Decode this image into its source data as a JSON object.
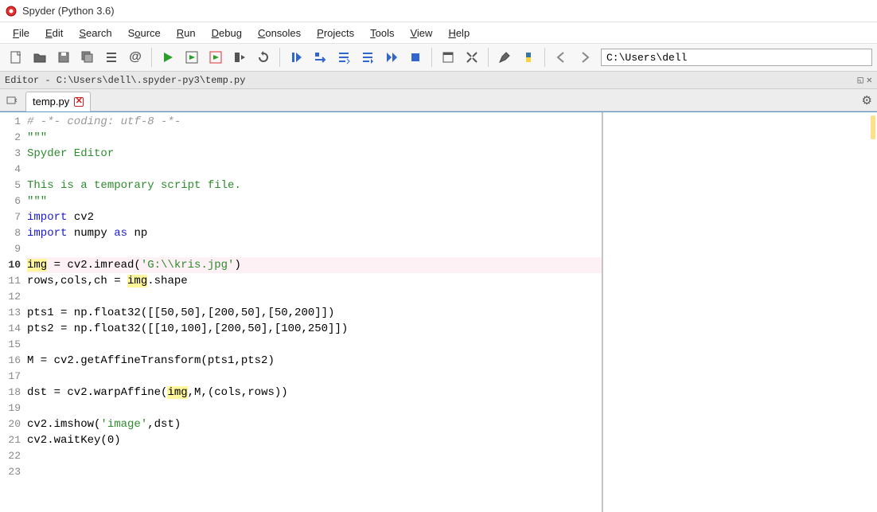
{
  "window": {
    "title": "Spyder (Python 3.6)"
  },
  "menu": {
    "file": "File",
    "edit": "Edit",
    "search": "Search",
    "source": "Source",
    "run": "Run",
    "debug": "Debug",
    "consoles": "Consoles",
    "projects": "Projects",
    "tools": "Tools",
    "view": "View",
    "help": "Help"
  },
  "toolbar": {
    "path_value": "C:\\Users\\dell"
  },
  "editor": {
    "pane_title": "Editor - C:\\Users\\dell\\.spyder-py3\\temp.py",
    "tab_name": "temp.py"
  },
  "code": {
    "lines": [
      {
        "n": 1,
        "frags": [
          {
            "t": "# -*- coding: utf-8 -*-",
            "cls": "tok-comment"
          }
        ]
      },
      {
        "n": 2,
        "frags": [
          {
            "t": "\"\"\"",
            "cls": "tok-str"
          }
        ]
      },
      {
        "n": 3,
        "frags": [
          {
            "t": "Spyder Editor",
            "cls": "tok-str"
          }
        ]
      },
      {
        "n": 4,
        "frags": [
          {
            "t": "",
            "cls": ""
          }
        ]
      },
      {
        "n": 5,
        "frags": [
          {
            "t": "This is a temporary script file.",
            "cls": "tok-str"
          }
        ]
      },
      {
        "n": 6,
        "frags": [
          {
            "t": "\"\"\"",
            "cls": "tok-str"
          }
        ]
      },
      {
        "n": 7,
        "frags": [
          {
            "t": "import",
            "cls": "tok-kw"
          },
          {
            "t": " cv2",
            "cls": ""
          }
        ]
      },
      {
        "n": 8,
        "frags": [
          {
            "t": "import",
            "cls": "tok-kw"
          },
          {
            "t": " numpy ",
            "cls": ""
          },
          {
            "t": "as",
            "cls": "tok-kw"
          },
          {
            "t": " np",
            "cls": ""
          }
        ]
      },
      {
        "n": 9,
        "frags": [
          {
            "t": "",
            "cls": ""
          }
        ]
      },
      {
        "n": 10,
        "bold": true,
        "hl": true,
        "frags": [
          {
            "t": "img",
            "cls": "tok-hl"
          },
          {
            "t": " = cv2.imread(",
            "cls": ""
          },
          {
            "t": "'G:\\\\kris.jpg'",
            "cls": "tok-str"
          },
          {
            "t": ")",
            "cls": ""
          }
        ]
      },
      {
        "n": 11,
        "frags": [
          {
            "t": "rows,cols,ch = ",
            "cls": ""
          },
          {
            "t": "img",
            "cls": "tok-hl"
          },
          {
            "t": ".shape",
            "cls": ""
          }
        ]
      },
      {
        "n": 12,
        "frags": [
          {
            "t": "",
            "cls": ""
          }
        ]
      },
      {
        "n": 13,
        "frags": [
          {
            "t": "pts1 = np.float32([[50,50],[200,50],[50,200]])",
            "cls": ""
          }
        ]
      },
      {
        "n": 14,
        "frags": [
          {
            "t": "pts2 = np.float32([[10,100],[200,50],[100,250]])",
            "cls": ""
          }
        ]
      },
      {
        "n": 15,
        "frags": [
          {
            "t": "",
            "cls": ""
          }
        ]
      },
      {
        "n": 16,
        "frags": [
          {
            "t": "M = cv2.getAffineTransform(pts1,pts2)",
            "cls": ""
          }
        ]
      },
      {
        "n": 17,
        "frags": [
          {
            "t": "",
            "cls": ""
          }
        ]
      },
      {
        "n": 18,
        "frags": [
          {
            "t": "dst = cv2.warpAffine(",
            "cls": ""
          },
          {
            "t": "img",
            "cls": "tok-hl"
          },
          {
            "t": ",M,(cols,rows))",
            "cls": ""
          }
        ]
      },
      {
        "n": 19,
        "frags": [
          {
            "t": "",
            "cls": ""
          }
        ]
      },
      {
        "n": 20,
        "frags": [
          {
            "t": "cv2.imshow(",
            "cls": ""
          },
          {
            "t": "'image'",
            "cls": "tok-str"
          },
          {
            "t": ",dst)",
            "cls": ""
          }
        ]
      },
      {
        "n": 21,
        "frags": [
          {
            "t": "cv2.waitKey(0)",
            "cls": ""
          }
        ]
      },
      {
        "n": 22,
        "frags": [
          {
            "t": "",
            "cls": ""
          }
        ]
      },
      {
        "n": 23,
        "frags": [
          {
            "t": "",
            "cls": ""
          }
        ]
      }
    ]
  }
}
